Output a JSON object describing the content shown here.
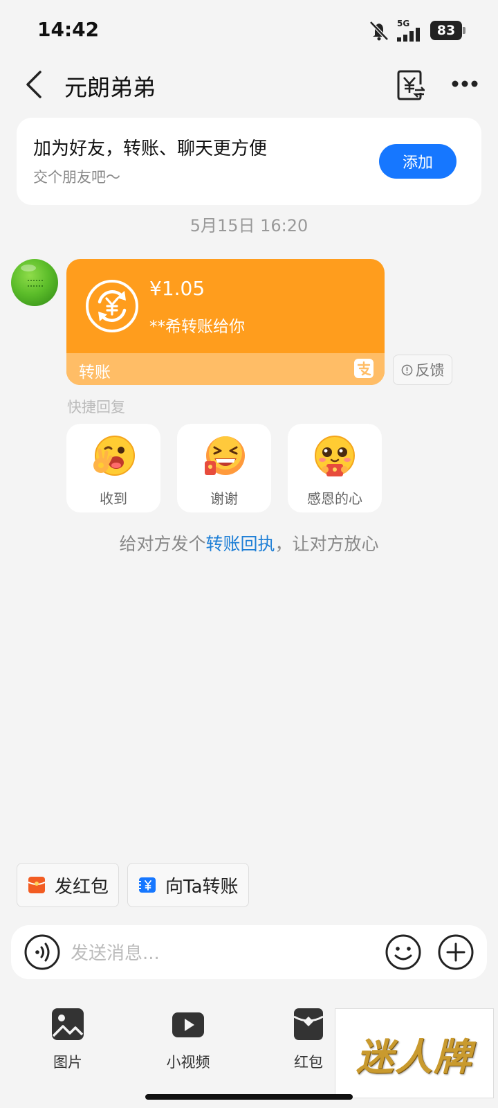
{
  "status_bar": {
    "time": "14:42",
    "network": "5G",
    "battery": "83"
  },
  "header": {
    "title": "元朗弟弟"
  },
  "friend_card": {
    "title": "加为好友，转账、聊天更方便",
    "subtitle": "交个朋友吧～",
    "add_label": "添加"
  },
  "chat": {
    "timestamp": "5月15日 16:20",
    "transfer": {
      "amount": "¥1.05",
      "payer": "**希转账给你",
      "footer_label": "转账"
    },
    "feedback_label": "反馈",
    "quick_reply_label": "快捷回复",
    "quick_replies": [
      {
        "label": "收到"
      },
      {
        "label": "谢谢"
      },
      {
        "label": "感恩的心"
      }
    ],
    "receipt_hint": {
      "prefix": "给对方发个",
      "link": "转账回执",
      "suffix": "，让对方放心"
    }
  },
  "shortcuts": {
    "red_packet": "发红包",
    "transfer": "向Ta转账"
  },
  "input": {
    "placeholder": "发送消息..."
  },
  "tools": [
    {
      "label": "图片",
      "icon": "image-icon"
    },
    {
      "label": "小视频",
      "icon": "video-icon"
    },
    {
      "label": "红包",
      "icon": "red-packet-icon"
    }
  ],
  "watermark": "迷人牌",
  "colors": {
    "accent": "#1677ff",
    "transfer_orange": "#ff9d1d",
    "link": "#1e7fd6"
  }
}
